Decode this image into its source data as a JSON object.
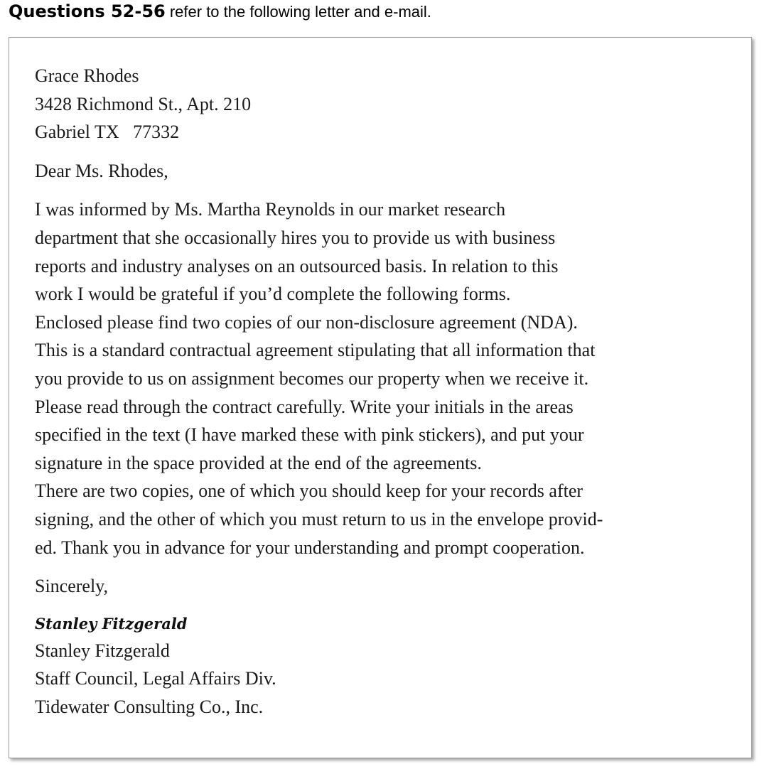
{
  "header": {
    "bold": "Questions 52-56",
    "rest": " refer to the following letter and e-mail."
  },
  "letter": {
    "address": [
      "Grace Rhodes",
      "3428 Richmond St., Apt. 210",
      "Gabriel TX   77332"
    ],
    "salutation": "Dear Ms. Rhodes,",
    "body_lines": [
      "I was informed by Ms. Martha Reynolds in our market research",
      "department that she occasionally hires you to provide us with business",
      "reports and industry analyses on an outsourced basis. In relation to this",
      "work I would be grateful if you’d complete the following forms.",
      "Enclosed please find two copies of our non-disclosure agreement (NDA).",
      "This is a standard contractual agreement stipulating that all information that",
      "you provide to us on assignment becomes our property when we receive it.",
      "Please read through the contract carefully. Write your initials in the areas",
      "specified in the text (I have marked these with pink stickers), and put your",
      "signature in the space provided at the end of the agreements.",
      "There are two copies, one of which you should keep for your records after",
      "signing, and the other of which you must return to us in the envelope provid-",
      "ed. Thank you in advance for your understanding and prompt cooperation."
    ],
    "closing": "Sincerely,",
    "signature": "Stanley Fitzgerald",
    "sender": [
      "Stanley Fitzgerald",
      "Staff Council, Legal Affairs Div.",
      "Tidewater Consulting Co., Inc."
    ]
  }
}
